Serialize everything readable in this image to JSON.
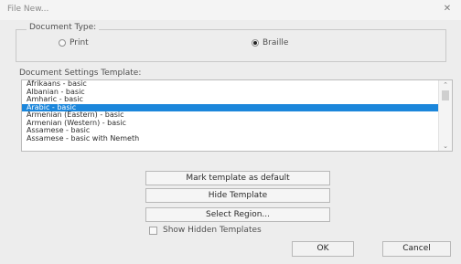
{
  "window": {
    "title": "File New...",
    "close_icon": "close-icon"
  },
  "document_type": {
    "legend": "Document Type:",
    "options": [
      {
        "label": "Print",
        "checked": false
      },
      {
        "label": "Braille",
        "checked": true
      }
    ]
  },
  "templates": {
    "label": "Document Settings Template:",
    "items": [
      "Afrikaans - basic",
      "Albanian - basic",
      "Amharic - basic",
      "Arabic - basic",
      "Armenian (Eastern) - basic",
      "Armenian (Western) - basic",
      "Assamese - basic",
      "Assamese - basic with Nemeth"
    ],
    "selected_index": 3
  },
  "buttons": {
    "mark_default": "Mark template as default",
    "hide_template": "Hide Template",
    "select_region": "Select Region..."
  },
  "show_hidden": {
    "label": "Show Hidden Templates",
    "checked": false
  },
  "footer": {
    "ok": "OK",
    "cancel": "Cancel"
  },
  "colors": {
    "selection": "#1b86db",
    "window_bg": "#ededed"
  }
}
